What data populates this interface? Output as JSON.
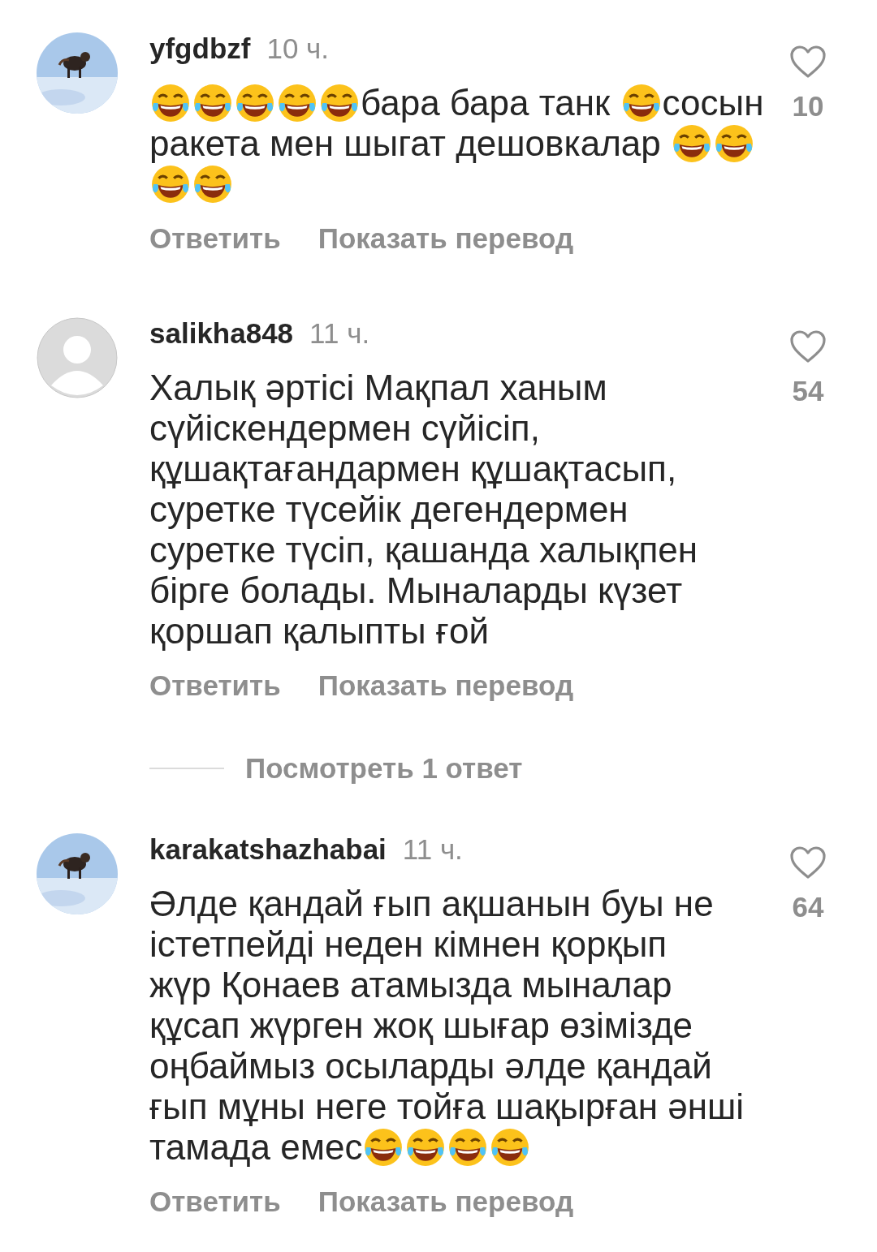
{
  "comments": [
    {
      "username": "yfgdbzf",
      "time": "10 ч.",
      "avatar": {
        "kind": "picture"
      },
      "liked": false,
      "likes": "10",
      "lines": [
        [
          {
            "kind": "emoji"
          },
          {
            "kind": "emoji"
          },
          {
            "kind": "emoji"
          },
          {
            "kind": "emoji"
          },
          {
            "kind": "emoji"
          },
          {
            "kind": "text",
            "text": "бара бара танк "
          },
          {
            "kind": "emoji"
          },
          {
            "kind": "text",
            "text": "сосын"
          }
        ],
        [
          {
            "kind": "text",
            "text": "ракета мен шыгат дешовкалар "
          },
          {
            "kind": "emoji"
          },
          {
            "kind": "emoji"
          }
        ],
        [
          {
            "kind": "emoji"
          },
          {
            "kind": "emoji"
          }
        ]
      ],
      "actions": [
        "Ответить",
        "Показать перевод"
      ]
    },
    {
      "username": "salikha848",
      "time": "11 ч.",
      "avatar": {
        "kind": "placeholder"
      },
      "liked": false,
      "likes": "54",
      "lines": [
        [
          {
            "kind": "text",
            "text": "Халық әртісі Мақпал ханым"
          }
        ],
        [
          {
            "kind": "text",
            "text": "сүйіскендермен сүйісіп,"
          }
        ],
        [
          {
            "kind": "text",
            "text": "құшақтағандармен құшақтасып,"
          }
        ],
        [
          {
            "kind": "text",
            "text": "суретке түсейік дегендермен"
          }
        ],
        [
          {
            "kind": "text",
            "text": "суретке түсіп, қашанда халықпен"
          }
        ],
        [
          {
            "kind": "text",
            "text": "бірге болады. Мыналарды күзет"
          }
        ],
        [
          {
            "kind": "text",
            "text": "қоршап қалыпты ғой"
          }
        ]
      ],
      "actions": [
        "Ответить",
        "Показать перевод"
      ],
      "view_replies": "Посмотреть 1 ответ"
    },
    {
      "username": "karakatshazhabai",
      "time": "11 ч.",
      "avatar": {
        "kind": "picture"
      },
      "liked": false,
      "likes": "64",
      "lines": [
        [
          {
            "kind": "text",
            "text": "Әлде қандай ғып ақшанын буы не"
          }
        ],
        [
          {
            "kind": "text",
            "text": "істетпейді неден кімнен қорқып"
          }
        ],
        [
          {
            "kind": "text",
            "text": "жүр Қонаев атамызда мыналар"
          }
        ],
        [
          {
            "kind": "text",
            "text": "құсап жүрген жоқ шығар өзімізде"
          }
        ],
        [
          {
            "kind": "text",
            "text": "оңбаймыз осыларды әлде қандай"
          }
        ],
        [
          {
            "kind": "text",
            "text": "ғып мұны неге тойға шақырған әнші"
          }
        ],
        [
          {
            "kind": "text",
            "text": "тамада емес"
          },
          {
            "kind": "emoji"
          },
          {
            "kind": "emoji"
          },
          {
            "kind": "emoji"
          },
          {
            "kind": "emoji"
          }
        ]
      ],
      "actions": [
        "Ответить",
        "Показать перевод"
      ]
    }
  ]
}
